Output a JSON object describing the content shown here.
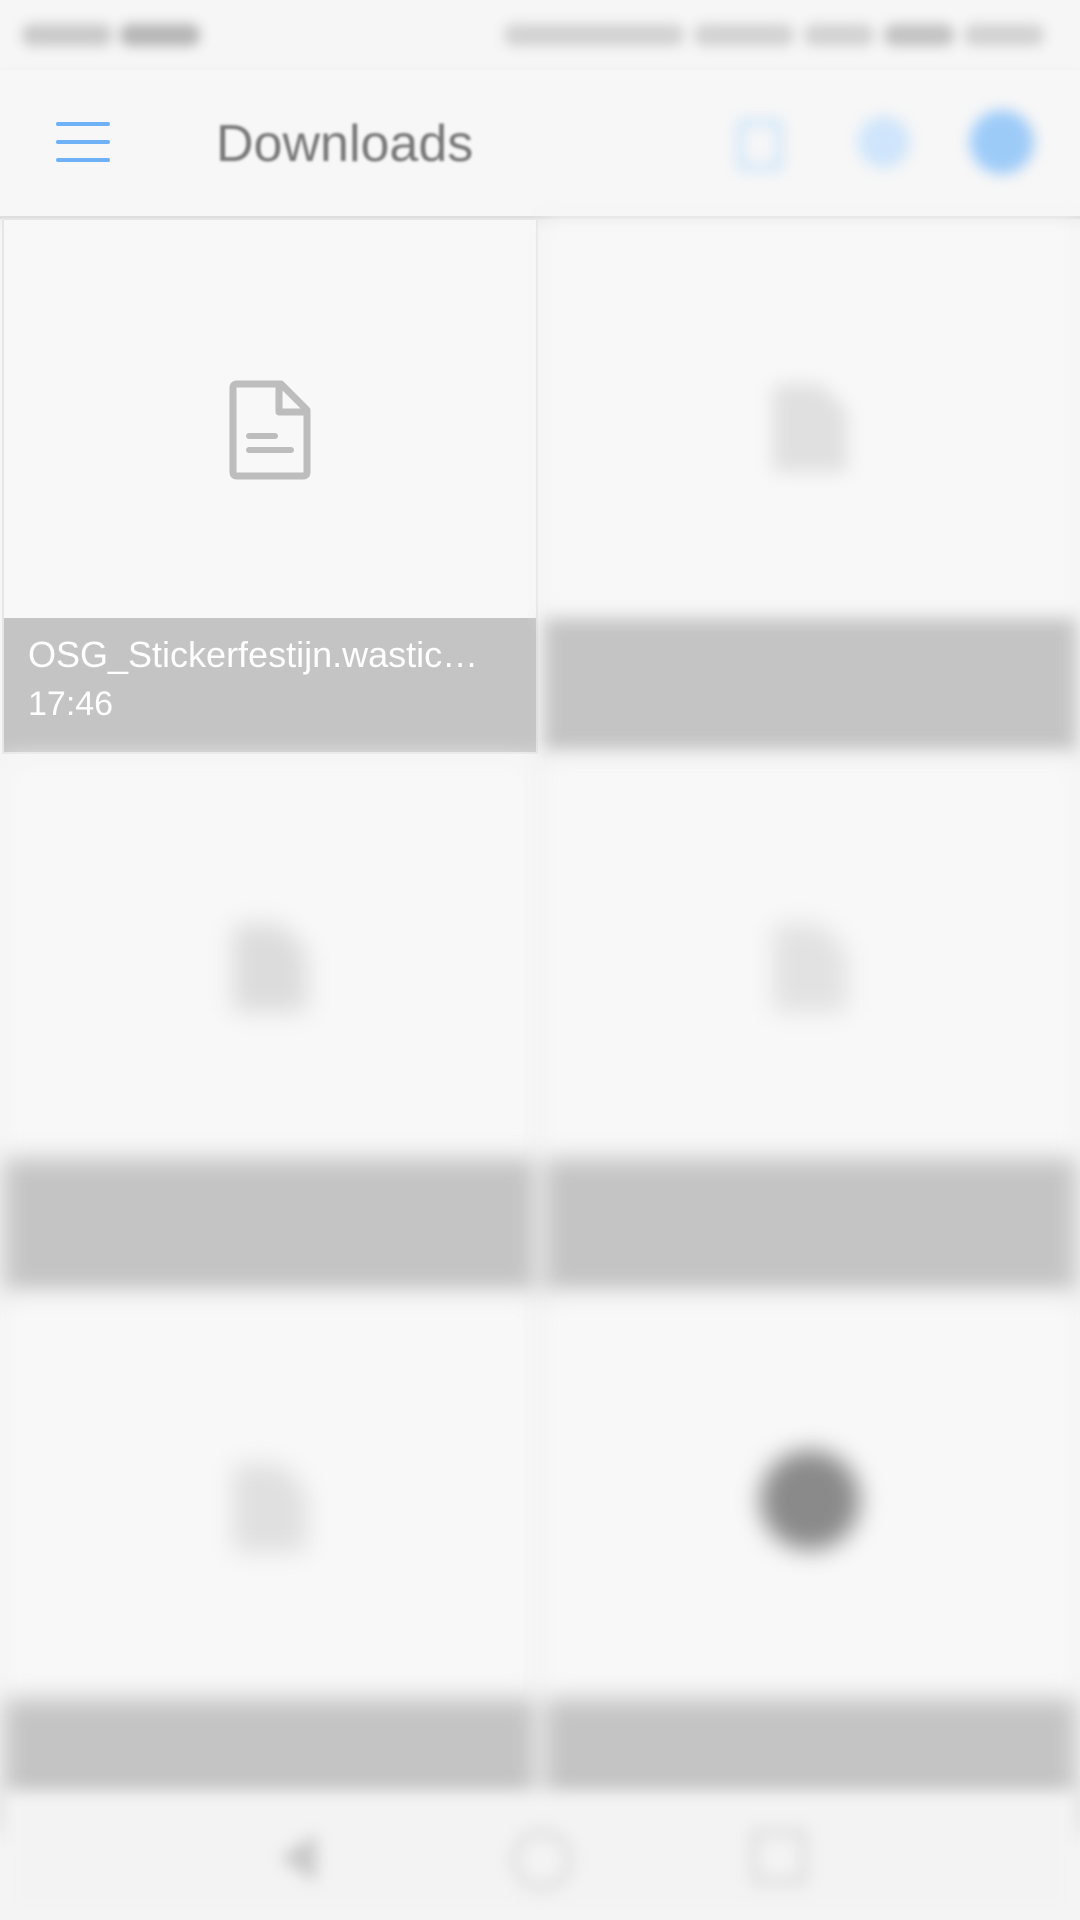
{
  "app_bar": {
    "title": "Downloads",
    "accent_color": "#6fb1f6"
  },
  "files": [
    {
      "name": "OSG_Stickerfestijn.wastic…",
      "time": "17:46",
      "icon": "document-icon"
    },
    {
      "name": "",
      "time": "",
      "icon": "document-icon"
    },
    {
      "name": "",
      "time": "",
      "icon": "document-icon"
    },
    {
      "name": "",
      "time": "",
      "icon": "document-icon"
    },
    {
      "name": "",
      "time": "",
      "icon": "document-icon"
    },
    {
      "name": "",
      "time": "",
      "icon": "image-thumbnail"
    }
  ],
  "icons": {
    "menu": "hamburger-menu-icon",
    "action_1": "edit-icon",
    "action_2": "share-icon",
    "action_3": "profile-icon",
    "nav_back": "back-icon",
    "nav_home": "home-icon",
    "nav_recent": "recent-apps-icon"
  },
  "colors": {
    "caption_bg": "#c4c4c4",
    "tile_bg": "#f8f8f8",
    "icon_gray": "#bdbdbd"
  }
}
